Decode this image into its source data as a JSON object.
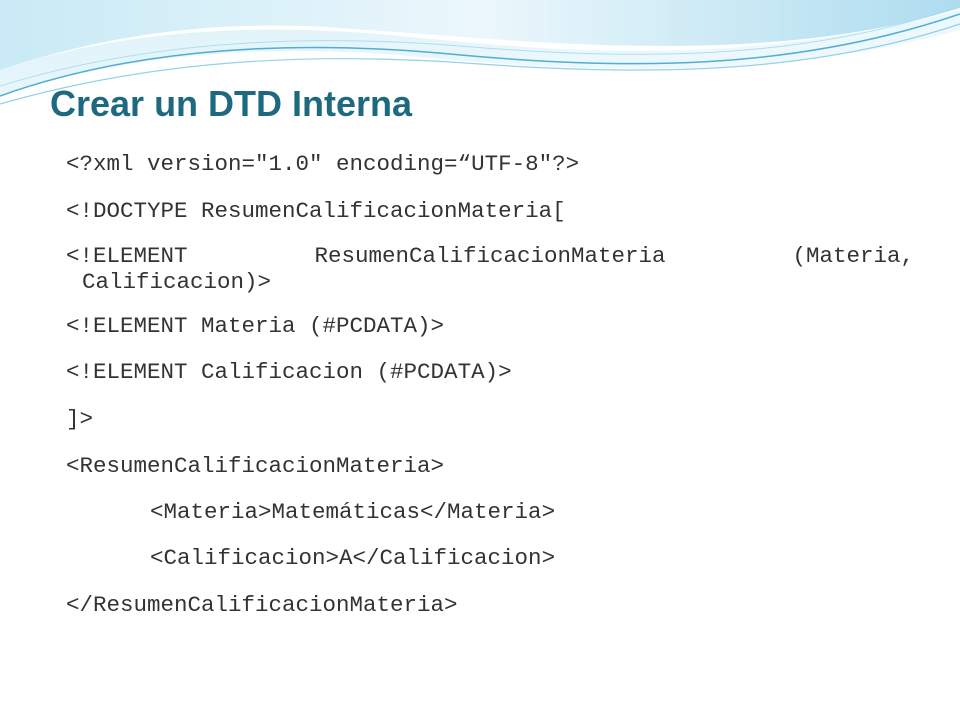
{
  "slide": {
    "title": "Crear un DTD Interna",
    "code_lines": [
      "<?xml version=\"1.0\" encoding=“UTF-8\"?>",
      "<!DOCTYPE ResumenCalificacionMateria[",
      "<!ELEMENT",
      "ResumenCalificacionMateria",
      "(Materia,",
      "Calificacion)>",
      "<!ELEMENT Materia (#PCDATA)>",
      "<!ELEMENT Calificacion (#PCDATA)>",
      "]>",
      "<ResumenCalificacionMateria>",
      "<Materia>Matemáticas</Materia>",
      "<Calificacion>A</Calificacion>",
      "</ResumenCalificacionMateria>"
    ]
  },
  "colors": {
    "title": "#1d6a80",
    "code_text": "#333333",
    "wave_light": "#dff1f8",
    "wave_mid": "#a9dbee",
    "wave_line": "#2a9bc9"
  }
}
